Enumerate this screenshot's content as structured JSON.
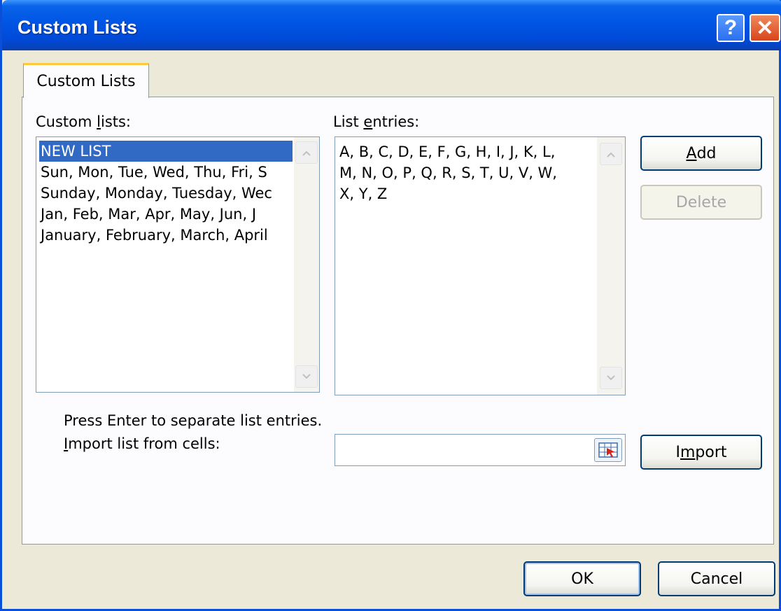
{
  "window": {
    "title": "Custom Lists",
    "help_glyph": "?",
    "close_glyph": "✕"
  },
  "tabs": [
    {
      "label": "Custom Lists",
      "active": true
    }
  ],
  "custom_lists": {
    "label_pre": "Custom ",
    "label_accel": "l",
    "label_post": "ists:",
    "items": [
      {
        "text": "NEW LIST",
        "selected": true
      },
      {
        "text": "Sun, Mon, Tue, Wed, Thu, Fri, S"
      },
      {
        "text": "Sunday, Monday, Tuesday, Wec"
      },
      {
        "text": "Jan, Feb, Mar, Apr, May, Jun, J"
      },
      {
        "text": "January, February, March, April"
      }
    ]
  },
  "list_entries": {
    "label_pre": "List ",
    "label_accel": "e",
    "label_post": "ntries:",
    "lines": [
      "A, B, C, D, E, F, G, H, I, J, K, L,",
      "M, N, O, P, Q, R, S, T, U, V, W,",
      "X, Y, Z"
    ]
  },
  "buttons": {
    "add_accel": "A",
    "add_rest": "dd",
    "delete": "Delete",
    "import_pre": "I",
    "import_accel": "m",
    "import_post": "port",
    "ok": "OK",
    "cancel": "Cancel"
  },
  "hint": "Press Enter to separate list entries.",
  "import": {
    "label_accel": "I",
    "label_rest": "mport list from cells:",
    "value": ""
  },
  "colors": {
    "title_bar": "#0055e5",
    "selection": "#316ac5",
    "tab_highlight": "#ffc83c"
  }
}
